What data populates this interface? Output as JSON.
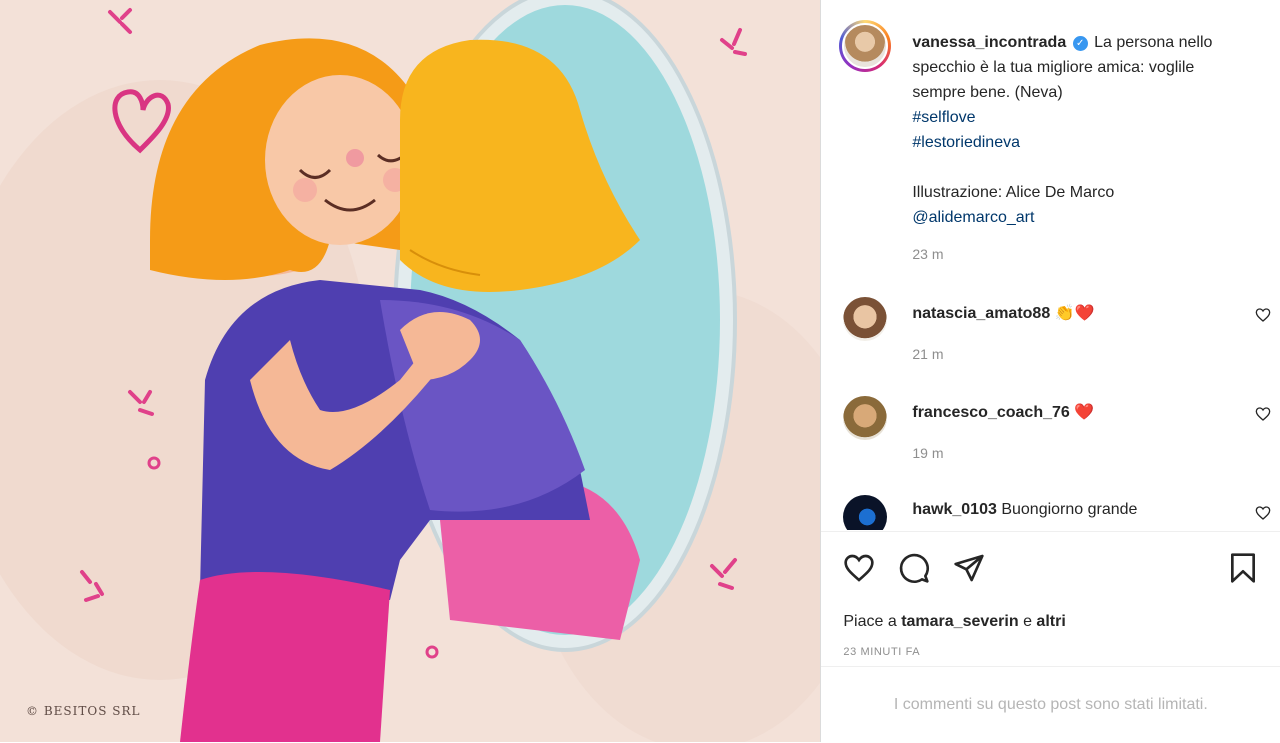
{
  "post": {
    "author": "vanessa_incontrada",
    "caption": "La persona nello specchio è la tua migliore amica: voglile sempre bene. (Neva)",
    "hashtags": [
      "#selflove",
      "#lestoriedineva"
    ],
    "credit_line": "Illustrazione: Alice De Marco",
    "credit_handle": "@alidemarco_art",
    "caption_time": "23 m",
    "image_watermark": "© BESITOS SRL"
  },
  "comments": [
    {
      "user": "natascia_amato88",
      "text": "👏❤️",
      "time": "21 m"
    },
    {
      "user": "francesco_coach_76",
      "text": "❤️",
      "time": "19 m"
    },
    {
      "user": "hawk_0103",
      "text": "Buongiorno grande",
      "time": ""
    }
  ],
  "actions": {
    "like_icon": "heart-icon",
    "comment_icon": "comment-icon",
    "share_icon": "paper-plane-icon",
    "save_icon": "bookmark-icon"
  },
  "likes": {
    "prefix": "Piace a",
    "user": "tamara_severin",
    "conj": "e",
    "others": "altri"
  },
  "timestamp": "23 MINUTI FA",
  "limited_notice": "I commenti su questo post sono stati limitati.",
  "colors": {
    "link": "#00376b",
    "muted": "#8e8e8e",
    "verified": "#3897f0"
  }
}
